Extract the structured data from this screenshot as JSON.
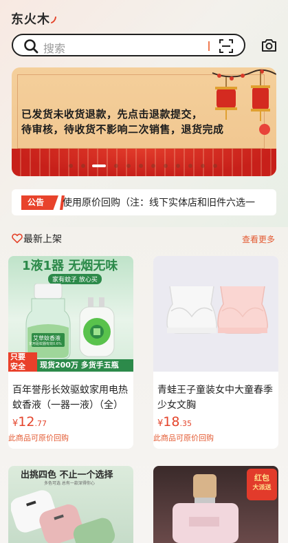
{
  "app": {
    "logo": "东火木"
  },
  "search": {
    "placeholder": "搜索"
  },
  "banner": {
    "line1": "已发货未收货退款，先点击退款提交，",
    "line2": "待审核，待收货不影响二次销售，退货完成",
    "slide_count": 14,
    "active_slide": 3
  },
  "notice": {
    "tag": "公告",
    "text": "使用原价回购（注：线下实体店和旧件六选一"
  },
  "section": {
    "title": "最新上架",
    "more": "查看更多"
  },
  "products": [
    {
      "title": "百年誉彤长效驱蚊家用电热蚊香液（一器一液）（全）",
      "currency": "¥",
      "price_int": "12",
      "price_dec": ".77",
      "note": "此商品可原价回购",
      "image": {
        "headline": "1液1器 无烟无味",
        "sub": "家有蚊子 放心买",
        "bottle_label": "艾草蚊香液",
        "bottle_sub": "家用驱蚊器有效0.6%",
        "badge_top": "只要",
        "badge_bottom": "安全",
        "promo": "现货200万 多货手五瓶"
      }
    },
    {
      "title": "青蛙王子童装女中大童春季少女文胸",
      "currency": "¥",
      "price_int": "18",
      "price_dec": ".35",
      "note": "此商品可原价回购"
    },
    {
      "image": {
        "headline": "出挑四色 不止一个选择",
        "sub": "多色可选 总有一款深得你心"
      }
    },
    {
      "image": {
        "badge_top": "红包",
        "badge_bottom": "大派送"
      }
    }
  ],
  "colors": {
    "accent": "#e4442b",
    "link": "#e35a32"
  }
}
